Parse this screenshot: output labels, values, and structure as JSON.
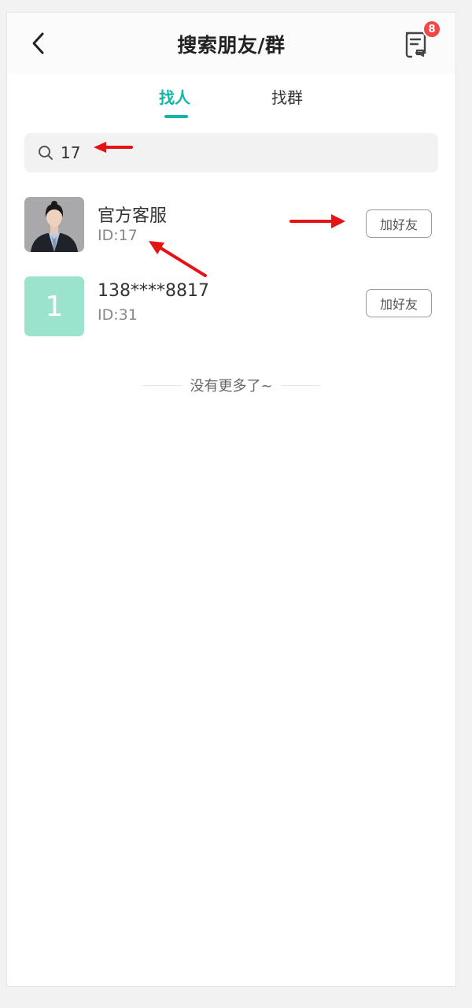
{
  "header": {
    "title": "搜索朋友/群",
    "back_icon": "chevron-left-icon",
    "message_icon": "message-list-icon",
    "message_badge": "8"
  },
  "tabs": [
    {
      "label": "找人",
      "active": true
    },
    {
      "label": "找群",
      "active": false
    }
  ],
  "search": {
    "icon": "search-icon",
    "value": "17"
  },
  "results": [
    {
      "name": "官方客服",
      "id_text": "ID:17",
      "avatar_type": "photo",
      "button": "加好友"
    },
    {
      "name": "138****8817",
      "id_text": "ID:31",
      "avatar_type": "text",
      "avatar_text": "1",
      "avatar_color": "#9be3cc",
      "button": "加好友"
    }
  ],
  "footer": {
    "no_more": "没有更多了~"
  },
  "colors": {
    "accent": "#13b5a9",
    "badge": "#f04848",
    "annotation_arrow": "#e41414"
  }
}
